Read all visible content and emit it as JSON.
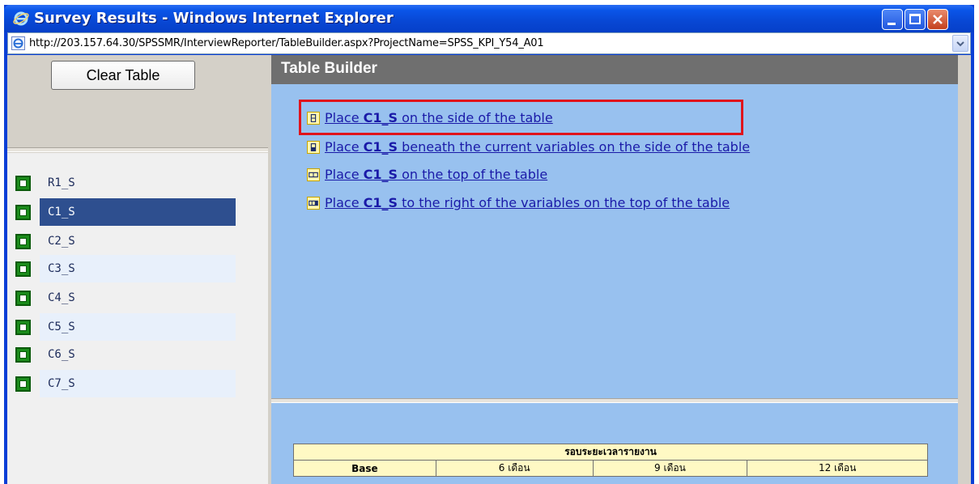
{
  "window": {
    "title": "Survey Results - Windows Internet Explorer",
    "address": "http://203.157.64.30/SPSSMR/InterviewReporter/TableBuilder.aspx?ProjectName=SPSS_KPI_Y54_A01"
  },
  "sidebar": {
    "clear_button": "Clear Table",
    "variables": [
      {
        "label": "R1_S",
        "selected": false
      },
      {
        "label": "C1_S",
        "selected": true
      },
      {
        "label": "C2_S",
        "selected": false
      },
      {
        "label": "C3_S",
        "selected": false
      },
      {
        "label": "C4_S",
        "selected": false
      },
      {
        "label": "C5_S",
        "selected": false
      },
      {
        "label": "C6_S",
        "selected": false
      },
      {
        "label": "C7_S",
        "selected": false
      }
    ]
  },
  "builder": {
    "header": "Table Builder",
    "variable": "C1_S",
    "options": [
      {
        "pre": "Place ",
        "var": "C1_S",
        "post": " on the side of the table",
        "icon": "side-icon"
      },
      {
        "pre": "Place ",
        "var": "C1_S",
        "post": " beneath the current variables on the side of the table",
        "icon": "side-beneath-icon"
      },
      {
        "pre": "Place ",
        "var": "C1_S",
        "post": " on the top of the table",
        "icon": "top-icon"
      },
      {
        "pre": "Place ",
        "var": "C1_S",
        "post": " to the right of the variables on the top of the table",
        "icon": "top-right-icon"
      }
    ]
  },
  "preview": {
    "header": "รอบระยะเวลารายงาน",
    "columns": [
      "Base",
      "6 เดือน",
      "9 เดือน",
      "12 เดือน"
    ]
  },
  "colors": {
    "selected_bg": "#2e4f8f",
    "panel_bg": "#98c1ef",
    "highlight": "#e0141c"
  }
}
